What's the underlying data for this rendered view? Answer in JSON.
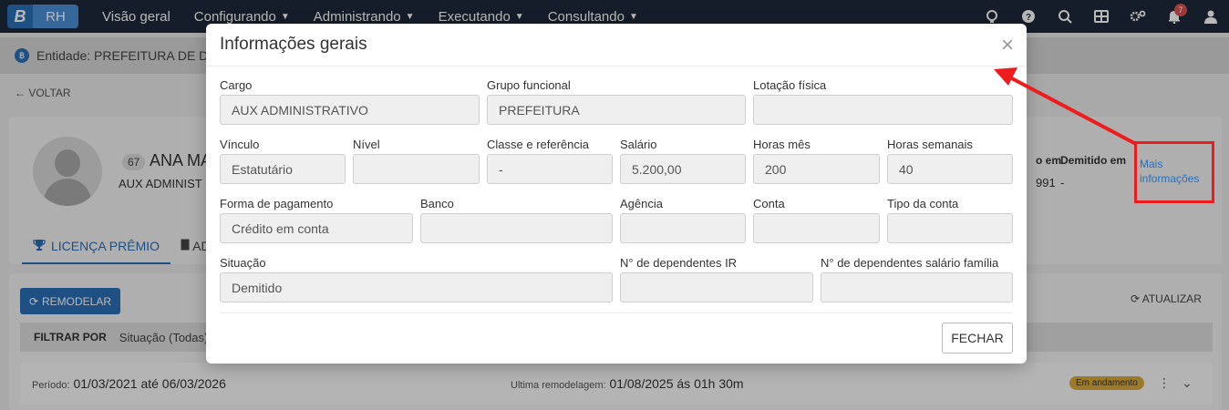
{
  "nav": {
    "logo_b": "B",
    "logo_rh": "RH",
    "links": [
      {
        "label": "Visão geral",
        "has_dropdown": false
      },
      {
        "label": "Configurando",
        "has_dropdown": true
      },
      {
        "label": "Administrando",
        "has_dropdown": true
      },
      {
        "label": "Executando",
        "has_dropdown": true
      },
      {
        "label": "Consultando",
        "has_dropdown": true
      }
    ],
    "icons": [
      "support-icon",
      "help-icon",
      "search-icon",
      "apps-icon",
      "settings-icon",
      "notifications-icon",
      "user-icon"
    ],
    "notification_count": "7"
  },
  "entity": {
    "text": "Entidade: PREFEITURA DE DE"
  },
  "back": {
    "label": "← VOLTAR"
  },
  "profile": {
    "id": "67",
    "name": "ANA MA",
    "role": "AUX ADMINIST",
    "admitido_label": "o em",
    "admitido_value": "991",
    "demitido_label": "Demitido em",
    "demitido_value": "-",
    "mais_info": "Mais informações"
  },
  "tabs": {
    "licenca": "LICENÇA PRÊMIO",
    "ad": "AD"
  },
  "toolbar": {
    "remodelar": "REMODELAR",
    "atualizar": "ATUALIZAR"
  },
  "filter": {
    "label": "FILTRAR POR",
    "value": "Situação (Todas)"
  },
  "record": {
    "periodo_label": "Período:",
    "periodo_value": "01/03/2021 até 06/03/2026",
    "ultima_label": "Ultima remodelagem:",
    "ultima_value": "01/08/2025 ás 01h 30m",
    "status": "Em andamento"
  },
  "modal": {
    "title": "Informações gerais",
    "close_button": "FECHAR",
    "fields": {
      "cargo": {
        "label": "Cargo",
        "value": "AUX ADMINISTRATIVO"
      },
      "grupo": {
        "label": "Grupo funcional",
        "value": "PREFEITURA"
      },
      "lotacao": {
        "label": "Lotação física",
        "value": ""
      },
      "vinculo": {
        "label": "Vínculo",
        "value": "Estatutário"
      },
      "nivel": {
        "label": "Nível",
        "value": ""
      },
      "classe": {
        "label": "Classe e referência",
        "value": "-"
      },
      "salario": {
        "label": "Salário",
        "value": "5.200,00"
      },
      "horas_mes": {
        "label": "Horas mês",
        "value": "200"
      },
      "horas_semanais": {
        "label": "Horas semanais",
        "value": "40"
      },
      "forma_pagamento": {
        "label": "Forma de pagamento",
        "value": "Crédito em conta"
      },
      "banco": {
        "label": "Banco",
        "value": ""
      },
      "agencia": {
        "label": "Agência",
        "value": ""
      },
      "conta": {
        "label": "Conta",
        "value": ""
      },
      "tipo_conta": {
        "label": "Tipo da conta",
        "value": ""
      },
      "situacao": {
        "label": "Situação",
        "value": "Demitido"
      },
      "dependentes_ir": {
        "label": "N° de dependentes IR",
        "value": ""
      },
      "dependentes_sf": {
        "label": "N° de dependentes salário família",
        "value": ""
      }
    }
  },
  "colors": {
    "nav_bg": "#1d2939",
    "brand_blue": "#2a6fb8",
    "annotation_red": "#ee1c1c",
    "status_pill": "#d9a93a"
  }
}
